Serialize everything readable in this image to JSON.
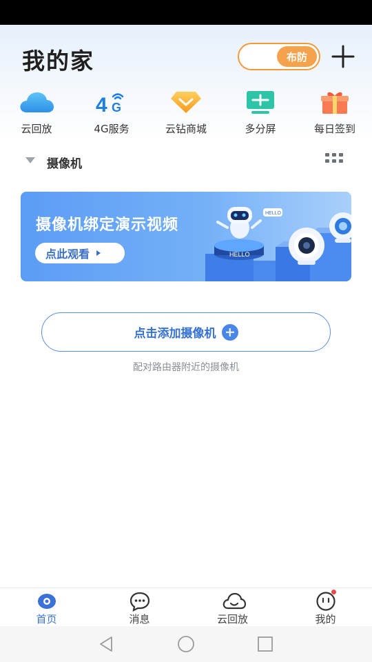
{
  "header": {
    "title": "我的家",
    "arm_toggle_label": "布防"
  },
  "quick_actions": [
    {
      "label": "云回放",
      "icon": "cloud-icon"
    },
    {
      "label": "4G服务",
      "icon": "4g-signal-icon"
    },
    {
      "label": "云钻商城",
      "icon": "diamond-icon"
    },
    {
      "label": "多分屏",
      "icon": "split-screen-icon"
    },
    {
      "label": "每日签到",
      "icon": "gift-icon"
    }
  ],
  "section": {
    "title": "摄像机"
  },
  "banner": {
    "title": "摄像机绑定演示视频",
    "button_label": "点此观看",
    "art_text": "HELLO"
  },
  "add_camera": {
    "label": "点击添加摄像机",
    "hint": "配对路由器附近的摄像机"
  },
  "tabs": [
    {
      "label": "首页",
      "icon": "home-eye-icon",
      "active": true
    },
    {
      "label": "消息",
      "icon": "message-icon",
      "active": false
    },
    {
      "label": "云回放",
      "icon": "cloud-playback-icon",
      "active": false
    },
    {
      "label": "我的",
      "icon": "profile-face-icon",
      "active": false,
      "badge": true
    }
  ],
  "colors": {
    "accent": "#3a72d8",
    "arm_orange": "#f5a24d",
    "banner_blue": "#5b9df5"
  }
}
